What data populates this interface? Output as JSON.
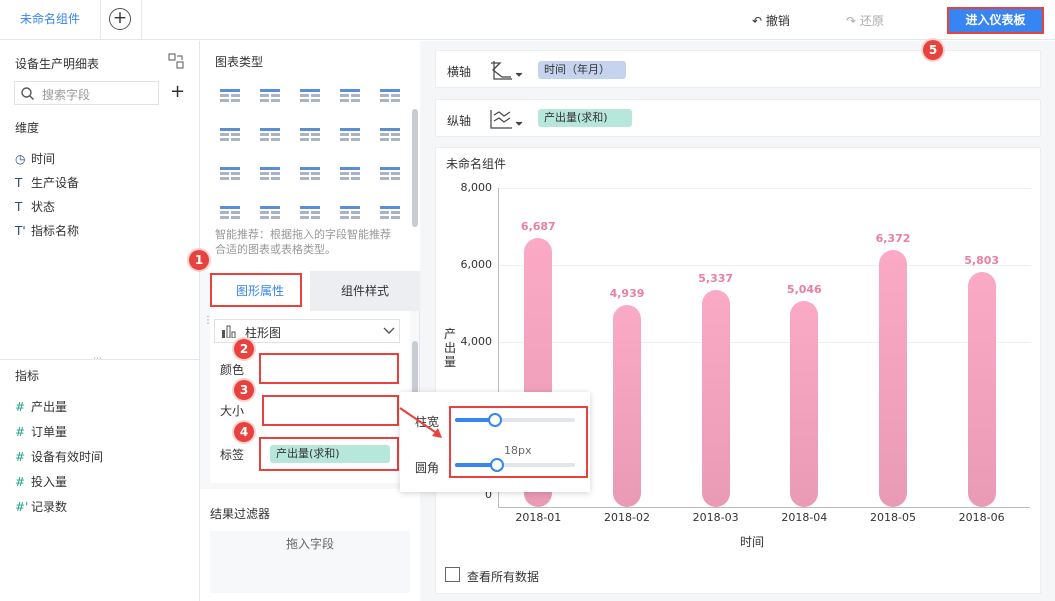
{
  "topbar": {
    "tab_label": "未命名组件",
    "add_tab": "+",
    "undo": "撤销",
    "redo": "还原",
    "enter_dashboard": "进入仪表板"
  },
  "fields_panel": {
    "table_name": "设备生产明细表",
    "search_placeholder": "搜索字段",
    "dimension_title": "维度",
    "dimensions": [
      {
        "icon": "clock-icon",
        "glyph": "◷",
        "label": "时间"
      },
      {
        "icon": "text-icon",
        "glyph": "T",
        "label": "生产设备"
      },
      {
        "icon": "text-icon",
        "glyph": "T",
        "label": "状态"
      },
      {
        "icon": "text-calc-icon",
        "glyph": "T'",
        "label": "指标名称"
      }
    ],
    "measure_title": "指标",
    "measures": [
      {
        "icon": "hash-icon",
        "glyph": "#",
        "label": "产出量"
      },
      {
        "icon": "hash-icon",
        "glyph": "#",
        "label": "订单量"
      },
      {
        "icon": "hash-icon",
        "glyph": "#",
        "label": "设备有效时间"
      },
      {
        "icon": "hash-icon",
        "glyph": "#",
        "label": "投入量"
      },
      {
        "icon": "hash-calc-icon",
        "glyph": "#'",
        "label": "记录数"
      }
    ]
  },
  "config_panel": {
    "chart_type_title": "图表类型",
    "smart_hint": "智能推荐：根据拖入的字段智能推荐合适的图表或表格类型。",
    "tabs": {
      "shape_attr": "图形属性",
      "component_style": "组件样式"
    },
    "chart_select": "柱形图",
    "props": {
      "color": "颜色",
      "size": "大小",
      "label": "标签"
    },
    "label_pill": "产出量(求和)",
    "filter_title": "结果过滤器",
    "filter_drop": "拖入字段"
  },
  "size_popup": {
    "width_label": "柱宽",
    "radius_label": "圆角",
    "radius_value": "18px",
    "width_fraction": 0.33,
    "radius_fraction": 0.35
  },
  "axes": {
    "x_label": "横轴",
    "x_pill": "时间（年月）",
    "y_label": "纵轴",
    "y_pill": "产出量(求和)"
  },
  "component_title": "未命名组件",
  "show_all": "查看所有数据",
  "badges": [
    "1",
    "2",
    "3",
    "4",
    "5"
  ],
  "colors": {
    "accent": "#3685f2",
    "highlight": "#e8423f",
    "bar": "#f7a4c0",
    "bar_label": "#e8809f",
    "x_pill": "#c5d3ef",
    "y_pill": "#b7e6da"
  },
  "chart_data": {
    "type": "bar",
    "categories": [
      "2018-01",
      "2018-02",
      "2018-03",
      "2018-04",
      "2018-05",
      "2018-06"
    ],
    "values": [
      6687,
      4939,
      5337,
      5046,
      6372,
      5803
    ],
    "value_labels": [
      "6,687",
      "4,939",
      "5,337",
      "5,046",
      "6,372",
      "5,803"
    ],
    "xlabel": "时间",
    "ylabel": "产出量",
    "yticks": [
      "8,000",
      "6,000",
      "4,000",
      "0"
    ],
    "ylim": [
      0,
      8000
    ]
  }
}
